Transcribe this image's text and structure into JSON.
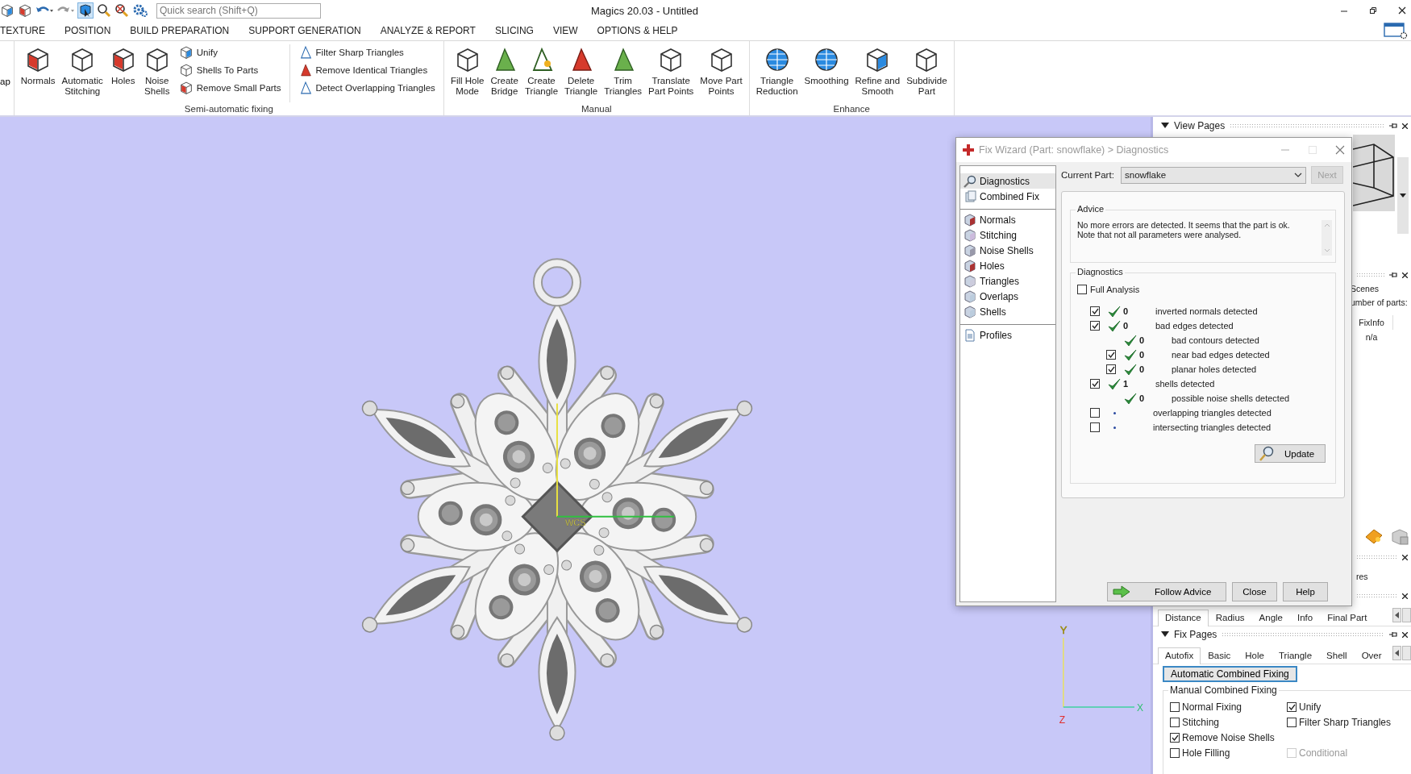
{
  "app": {
    "title": "Magics 20.03 - Untitled",
    "search_placeholder": "Quick search (Shift+Q)"
  },
  "menu": [
    "TEXTURE",
    "POSITION",
    "BUILD PREPARATION",
    "SUPPORT GENERATION",
    "ANALYZE & REPORT",
    "SLICING",
    "VIEW",
    "OPTIONS & HELP"
  ],
  "ribbon": {
    "groups": [
      {
        "items": [
          {
            "kind": "cut",
            "lines": [
              "ap"
            ]
          }
        ]
      },
      {
        "label": "Semi-automatic fixing",
        "items": [
          {
            "kind": "large",
            "lines": [
              "Normals"
            ]
          },
          {
            "kind": "large",
            "lines": [
              "Automatic",
              "Stitching"
            ]
          },
          {
            "kind": "large",
            "lines": [
              "Holes"
            ]
          },
          {
            "kind": "large",
            "lines": [
              "Noise",
              "Shells"
            ]
          },
          {
            "kind": "stack",
            "buttons": [
              "Unify",
              "Shells To Parts",
              "Remove Small Parts"
            ]
          },
          {
            "kind": "separator"
          },
          {
            "kind": "stack",
            "buttons": [
              "Filter Sharp Triangles",
              "Remove Identical Triangles",
              "Detect Overlapping Triangles"
            ]
          }
        ]
      },
      {
        "label": "Manual",
        "items": [
          {
            "kind": "large",
            "lines": [
              "Fill Hole",
              "Mode"
            ]
          },
          {
            "kind": "large",
            "lines": [
              "Create",
              "Bridge"
            ]
          },
          {
            "kind": "large",
            "lines": [
              "Create",
              "Triangle"
            ]
          },
          {
            "kind": "large",
            "lines": [
              "Delete",
              "Triangle"
            ]
          },
          {
            "kind": "large",
            "lines": [
              "Trim",
              "Triangles"
            ]
          },
          {
            "kind": "large",
            "lines": [
              "Translate",
              "Part Points"
            ]
          },
          {
            "kind": "large",
            "lines": [
              "Move Part",
              "Points"
            ]
          }
        ]
      },
      {
        "label": "Enhance",
        "items": [
          {
            "kind": "large",
            "lines": [
              "Triangle",
              "Reduction"
            ]
          },
          {
            "kind": "large",
            "lines": [
              "Smoothing"
            ]
          },
          {
            "kind": "large",
            "lines": [
              "Refine and",
              "Smooth"
            ]
          },
          {
            "kind": "large",
            "lines": [
              "Subdivide",
              "Part"
            ]
          }
        ]
      }
    ]
  },
  "viewport": {
    "marker": "WCS",
    "axes": {
      "y": "Y",
      "z": "Z",
      "x": "X"
    }
  },
  "fix_wizard": {
    "title": "Fix Wizard (Part: snowflake) > Diagnostics",
    "nav_groups": [
      {
        "items": [
          {
            "label": "Diagnostics",
            "selected": true
          },
          {
            "label": "Combined Fix",
            "selected": false
          }
        ]
      },
      {
        "items": [
          {
            "label": "Normals",
            "selected": false
          },
          {
            "label": "Stitching",
            "selected": false
          },
          {
            "label": "Noise Shells",
            "selected": false
          },
          {
            "label": "Holes",
            "selected": false
          },
          {
            "label": "Triangles",
            "selected": false
          },
          {
            "label": "Overlaps",
            "selected": false
          },
          {
            "label": "Shells",
            "selected": false
          }
        ]
      },
      {
        "items": [
          {
            "label": "Profiles",
            "selected": false
          }
        ]
      }
    ],
    "current_part_label": "Current Part:",
    "current_part": "snowflake",
    "next_button": {
      "label": "Next",
      "disabled": true
    },
    "advice": {
      "title": "Advice",
      "text": "No more errors are detected. It seems that the part is ok. Note that not all parameters were analysed."
    },
    "diagnostics": {
      "title": "Diagnostics",
      "full_analysis": {
        "label": "Full Analysis",
        "checked": false
      },
      "rows": [
        {
          "kind": "checkbox",
          "checked": true,
          "passed": true,
          "count": "0",
          "label": "inverted normals detected"
        },
        {
          "kind": "checkbox",
          "checked": true,
          "passed": true,
          "count": "0",
          "label": "bad edges detected",
          "children": [
            {
              "kind": "plain",
              "passed": true,
              "count": "0",
              "label": "bad contours detected"
            },
            {
              "kind": "checkbox",
              "checked": true,
              "passed": true,
              "count": "0",
              "label": "near bad edges detected"
            },
            {
              "kind": "checkbox",
              "checked": true,
              "passed": true,
              "count": "0",
              "label": "planar holes detected"
            }
          ]
        },
        {
          "kind": "checkbox",
          "checked": true,
          "passed": true,
          "count": "1",
          "label": "shells detected",
          "children": [
            {
              "kind": "plain",
              "passed": true,
              "count": "0",
              "label": "possible noise shells detected"
            }
          ]
        },
        {
          "kind": "checkbox",
          "checked": false,
          "passed": false,
          "label": "overlapping triangles detected"
        },
        {
          "kind": "checkbox",
          "checked": false,
          "passed": false,
          "label": "intersecting triangles detected"
        }
      ],
      "update_button": "Update"
    },
    "buttons": [
      "Follow Advice",
      "Close",
      "Help"
    ]
  },
  "right_panel": {
    "view_pages": {
      "title": "View Pages"
    },
    "scenes": {
      "line_1": "Scenes",
      "line_2": "umber of parts:",
      "column": "FixInfo",
      "value": "n/a"
    },
    "partial_label": "res",
    "measurement_tabs": [
      {
        "label": "Distance",
        "selected": true
      },
      {
        "label": "Radius",
        "selected": false
      },
      {
        "label": "Angle",
        "selected": false
      },
      {
        "label": "Info",
        "selected": false
      },
      {
        "label": "Final Part",
        "selected": false
      }
    ],
    "fix_pages": {
      "title": "Fix Pages",
      "tabs": [
        {
          "label": "Autofix",
          "selected": true
        },
        {
          "label": "Basic",
          "selected": false
        },
        {
          "label": "Hole",
          "selected": false
        },
        {
          "label": "Triangle",
          "selected": false
        },
        {
          "label": "Shell",
          "selected": false
        },
        {
          "label": "Over",
          "selected": false
        }
      ],
      "auto_button": "Automatic Combined Fixing",
      "group_title": "Manual Combined Fixing",
      "left_options": [
        {
          "label": "Normal Fixing",
          "checked": false
        },
        {
          "label": "Stitching",
          "checked": false
        },
        {
          "label": "Remove Noise Shells",
          "checked": true
        },
        {
          "label": "Hole Filling",
          "checked": false,
          "suboption": {
            "label": "Conditional",
            "checked": false,
            "disabled": true
          }
        }
      ],
      "right_options": [
        {
          "label": "Unify",
          "checked": true
        },
        {
          "label": "Filter Sharp Triangles",
          "checked": false
        }
      ]
    }
  }
}
